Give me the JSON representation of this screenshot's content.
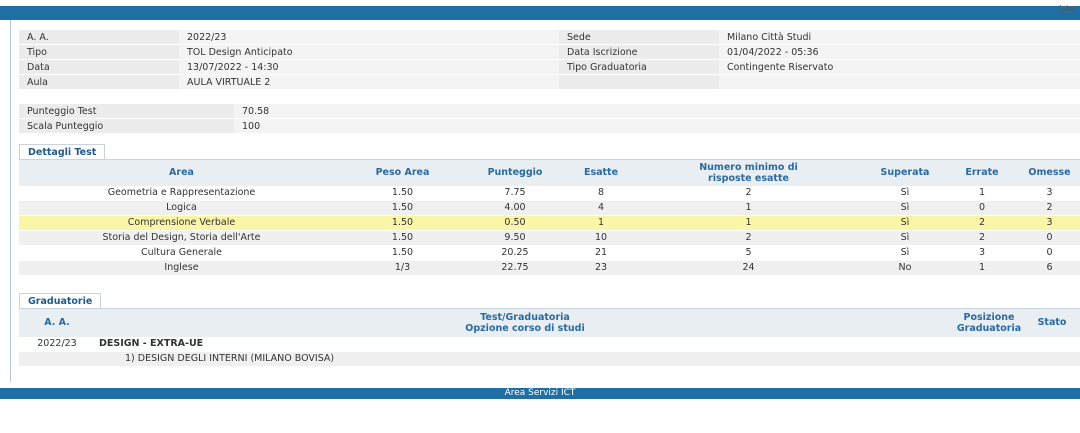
{
  "header": {
    "corner_text": "(sta"
  },
  "info": [
    {
      "label": "A. A.",
      "value": "2022/23",
      "label2": "Sede",
      "value2": "Milano Città Studi"
    },
    {
      "label": "Tipo",
      "value": "TOL Design Anticipato",
      "label2": "Data Iscrizione",
      "value2": "01/04/2022 - 05:36"
    },
    {
      "label": "Data",
      "value": "13/07/2022 - 14:30",
      "label2": "Tipo Graduatoria",
      "value2": "Contingente Riservato"
    },
    {
      "label": "Aula",
      "value": "AULA VIRTUALE 2",
      "label2": "",
      "value2": ""
    }
  ],
  "score": {
    "test_label": "Punteggio Test",
    "test_value": "70.58",
    "scale_label": "Scala Punteggio",
    "scale_value": "100"
  },
  "details": {
    "tab": "Dettagli Test",
    "headers": {
      "area": "Area",
      "peso": "Peso Area",
      "punteggio": "Punteggio",
      "esatte": "Esatte",
      "minimo_1": "Numero minimo di",
      "minimo_2": "risposte esatte",
      "superata": "Superata",
      "errate": "Errate",
      "omesse": "Omesse"
    },
    "rows": [
      {
        "area": "Geometria e Rappresentazione",
        "peso": "1.50",
        "punteggio": "7.75",
        "esatte": "8",
        "minimo": "2",
        "superata": "Sì",
        "errate": "1",
        "omesse": "3"
      },
      {
        "area": "Logica",
        "peso": "1.50",
        "punteggio": "4.00",
        "esatte": "4",
        "minimo": "1",
        "superata": "Sì",
        "errate": "0",
        "omesse": "2"
      },
      {
        "area": "Comprensione Verbale",
        "peso": "1.50",
        "punteggio": "0.50",
        "esatte": "1",
        "minimo": "1",
        "superata": "Sì",
        "errate": "2",
        "omesse": "3"
      },
      {
        "area": "Storia del Design, Storia dell'Arte",
        "peso": "1.50",
        "punteggio": "9.50",
        "esatte": "10",
        "minimo": "2",
        "superata": "Sì",
        "errate": "2",
        "omesse": "0"
      },
      {
        "area": "Cultura Generale",
        "peso": "1.50",
        "punteggio": "20.25",
        "esatte": "21",
        "minimo": "5",
        "superata": "Sì",
        "errate": "3",
        "omesse": "0"
      },
      {
        "area": "Inglese",
        "peso": "1/3",
        "punteggio": "22.75",
        "esatte": "23",
        "minimo": "24",
        "superata": "No",
        "errate": "1",
        "omesse": "6"
      }
    ]
  },
  "graduatorie": {
    "tab": "Graduatorie",
    "headers": {
      "aa": "A. A.",
      "test_1": "Test/Graduatoria",
      "test_2": "Opzione corso di studi",
      "pos_1": "Posizione",
      "pos_2": "Graduatoria",
      "stato": "Stato"
    },
    "row_aa": "2022/23",
    "row_title": "DESIGN - EXTRA-UE",
    "row_option": "1) DESIGN DEGLI INTERNI (MILANO BOVISA)"
  },
  "footer": {
    "label": "Area Servizi ICT"
  }
}
